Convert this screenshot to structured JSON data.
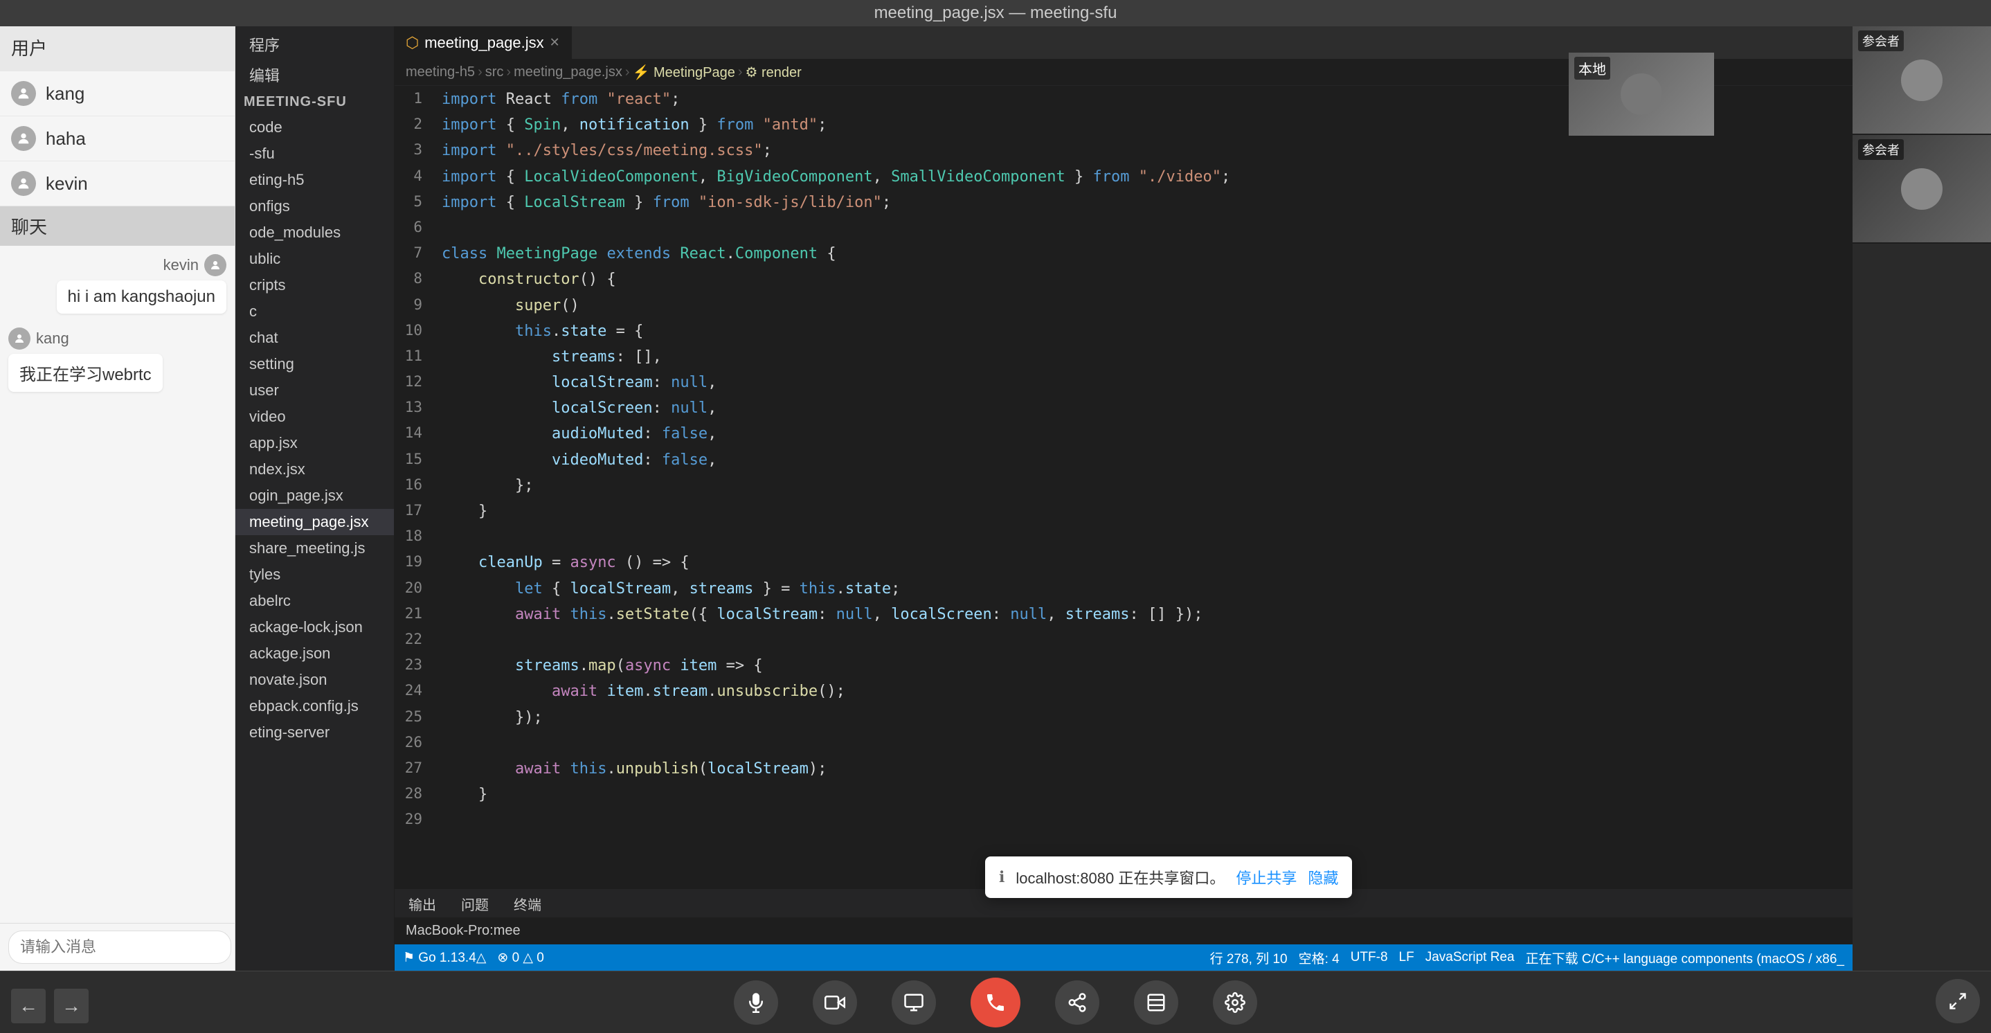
{
  "titlebar": {
    "text": "meeting_page.jsx — meeting-sfu"
  },
  "leftPanel": {
    "usersHeader": "用户",
    "users": [
      {
        "name": "kang"
      },
      {
        "name": "haha"
      },
      {
        "name": "kevin"
      }
    ],
    "chatHeader": "聊天",
    "messages": [
      {
        "sender": "kevin",
        "text": "hi i am kangshaojun",
        "type": "received"
      },
      {
        "sender": "kang",
        "text": "我正在学习webrtc",
        "type": "sent"
      }
    ],
    "inputPlaceholder": "请输入消息"
  },
  "fileTree": {
    "items": [
      {
        "name": "程序",
        "active": false
      },
      {
        "name": "编辑",
        "active": false
      },
      {
        "name": "MEETING-SFU",
        "type": "header"
      },
      {
        "name": "code",
        "active": false
      },
      {
        "name": "-sfu",
        "active": false
      },
      {
        "name": "eting-h5",
        "active": false
      },
      {
        "name": "onfigs",
        "active": false
      },
      {
        "name": "ode_modules",
        "active": false
      },
      {
        "name": "ublic",
        "active": false
      },
      {
        "name": "cripts",
        "active": false
      },
      {
        "name": "c",
        "active": false
      },
      {
        "name": "chat",
        "active": false
      },
      {
        "name": "setting",
        "active": false
      },
      {
        "name": "user",
        "active": false
      },
      {
        "name": "video",
        "active": false
      },
      {
        "name": "app.jsx",
        "active": false
      },
      {
        "name": "ndex.jsx",
        "active": false
      },
      {
        "name": "ogin_page.jsx",
        "active": false
      },
      {
        "name": "meeting_page.jsx",
        "active": true
      },
      {
        "name": "share_meeting.js",
        "active": false
      },
      {
        "name": "tyles",
        "active": false
      },
      {
        "name": "abelrc",
        "active": false
      },
      {
        "name": "ackage-lock.json",
        "active": false
      },
      {
        "name": "ackage.json",
        "active": false
      },
      {
        "name": "novate.json",
        "active": false
      },
      {
        "name": "ebpack.config.js",
        "active": false
      },
      {
        "name": "eting-server",
        "active": false
      }
    ]
  },
  "editor": {
    "tab": "meeting_page.jsx",
    "breadcrumb": [
      "meeting-h5",
      "src",
      "meeting_page.jsx",
      "MeetingPage",
      "render"
    ],
    "lines": [
      {
        "num": "1",
        "code": "import React from \"react\";"
      },
      {
        "num": "2",
        "code": "import { Spin, notification } from \"antd\";"
      },
      {
        "num": "3",
        "code": "import \"../styles/css/meeting.scss\";"
      },
      {
        "num": "4",
        "code": "import { LocalVideoComponent, BigVideoComponent, SmallVideoComponent } from \"./video\";"
      },
      {
        "num": "5",
        "code": "import { LocalStream } from \"ion-sdk-js/lib/ion\";"
      },
      {
        "num": "6",
        "code": ""
      },
      {
        "num": "7",
        "code": "class MeetingPage extends React.Component {"
      },
      {
        "num": "8",
        "code": "    constructor() {"
      },
      {
        "num": "9",
        "code": "        super()"
      },
      {
        "num": "10",
        "code": "        this.state = {"
      },
      {
        "num": "11",
        "code": "            streams: [],"
      },
      {
        "num": "12",
        "code": "            localStream: null,"
      },
      {
        "num": "13",
        "code": "            localScreen: null,"
      },
      {
        "num": "14",
        "code": "            audioMuted: false,"
      },
      {
        "num": "15",
        "code": "            videoMuted: false,"
      },
      {
        "num": "16",
        "code": "        };"
      },
      {
        "num": "17",
        "code": "    }"
      },
      {
        "num": "18",
        "code": ""
      },
      {
        "num": "19",
        "code": "    cleanUp = async () => {"
      },
      {
        "num": "20",
        "code": "        let { localStream, streams } = this.state;"
      },
      {
        "num": "21",
        "code": "        await this.setState({ localStream: null, localScreen: null, streams: [] });"
      },
      {
        "num": "22",
        "code": ""
      },
      {
        "num": "23",
        "code": "        streams.map(async item => {"
      },
      {
        "num": "24",
        "code": "            await item.stream.unsubscribe();"
      },
      {
        "num": "25",
        "code": "        });"
      },
      {
        "num": "26",
        "code": ""
      },
      {
        "num": "27",
        "code": "        await this.unpublish(localStream);"
      },
      {
        "num": "28",
        "code": "    }"
      },
      {
        "num": "29",
        "code": ""
      }
    ]
  },
  "bottomPanel": {
    "tabs": [
      "输出",
      "问题",
      "终端"
    ],
    "content": "MacBook-Pro:mee"
  },
  "statusBar": {
    "left": [
      "Go 1.13.4",
      "⊗ 0 △ 0"
    ],
    "right": [
      "行 278, 列 10",
      "空格: 4",
      "UTF-8",
      "LF",
      "JavaScript Rea",
      "正在下载 C/C++ language components (macOS / x86_"
    ]
  },
  "shareNotification": {
    "text": "localhost:8080 正在共享窗口。",
    "stopBtn": "停止共享",
    "hideBtn": "隐藏"
  },
  "meetingControls": {
    "buttons": [
      "mic",
      "camera",
      "screen",
      "endCall",
      "share",
      "layout",
      "settings",
      "fullscreen"
    ]
  },
  "videos": {
    "local": {
      "label": "本地"
    },
    "participants": [
      {
        "label": "参会者"
      },
      {
        "label": "参会者"
      }
    ]
  }
}
